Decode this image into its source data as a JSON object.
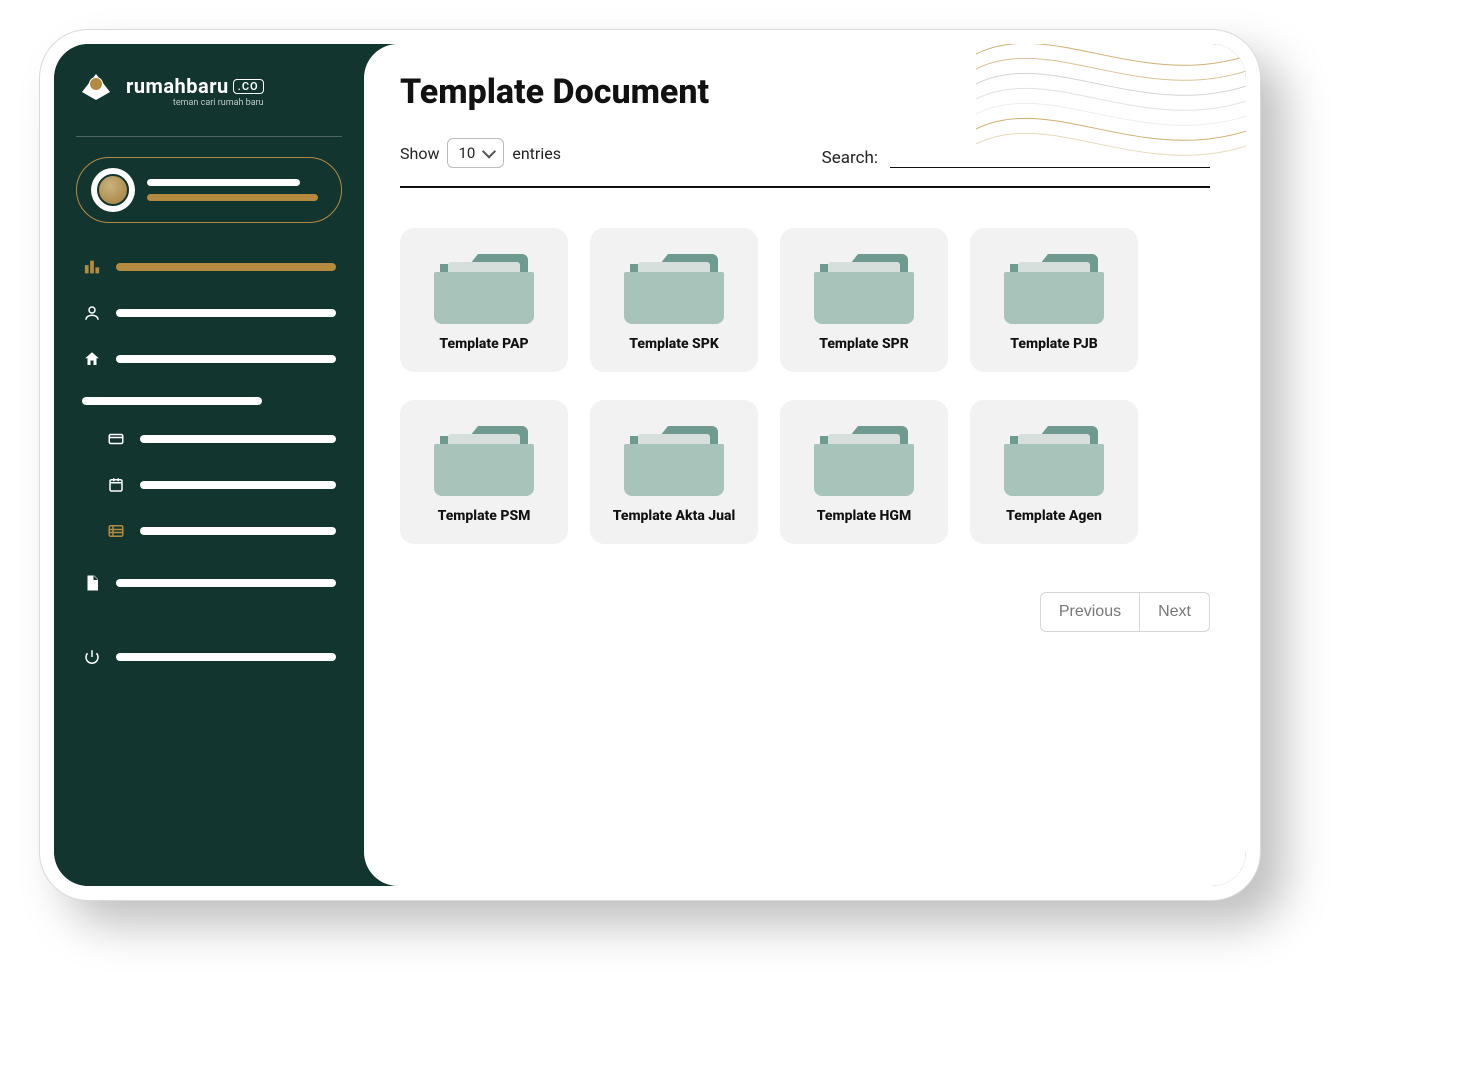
{
  "brand": {
    "name": "rumahbaru",
    "suffix": ".CO",
    "tagline": "teman cari rumah baru"
  },
  "page": {
    "title": "Template Document"
  },
  "controls": {
    "show_label": "Show",
    "entries_label": "entries",
    "per_page": "10",
    "search_label": "Search:",
    "search_value": ""
  },
  "folders": [
    {
      "name": "Template PAP"
    },
    {
      "name": "Template SPK"
    },
    {
      "name": "Template SPR"
    },
    {
      "name": "Template PJB"
    },
    {
      "name": "Template PSM"
    },
    {
      "name": "Template Akta Jual"
    },
    {
      "name": "Template HGM"
    },
    {
      "name": "Template Agen"
    }
  ],
  "pager": {
    "prev": "Previous",
    "next": "Next"
  }
}
